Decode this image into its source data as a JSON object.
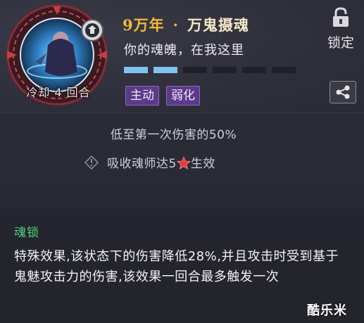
{
  "header": {
    "cooldown": "冷却 4 回合",
    "title_years": "9万年",
    "title_dot": "·",
    "title_name": "万鬼摄魂",
    "subtitle": "你的魂魄，在我这里",
    "progress": {
      "filled": 2,
      "total": 6
    },
    "tags": [
      "主动",
      "弱化"
    ],
    "lock_label": "锁定"
  },
  "body": {
    "line1": "低至第一次伤害的50%",
    "line2_prefix": "吸收魂师达5",
    "line2_suffix": "生效"
  },
  "effect": {
    "title": "魂锁",
    "text": "特殊效果,该状态下的伤害降低28%,并且攻击时受到基于鬼魅攻击力的伤害,该效果一回合最多触发一次"
  },
  "watermark": "酷乐米",
  "colors": {
    "gold": "#f0b93a",
    "tag_purple": "#5b3a87",
    "progress_blue": "#7fc3ee",
    "effect_green": "#4fd27a",
    "star_red": "#e33b3b"
  }
}
